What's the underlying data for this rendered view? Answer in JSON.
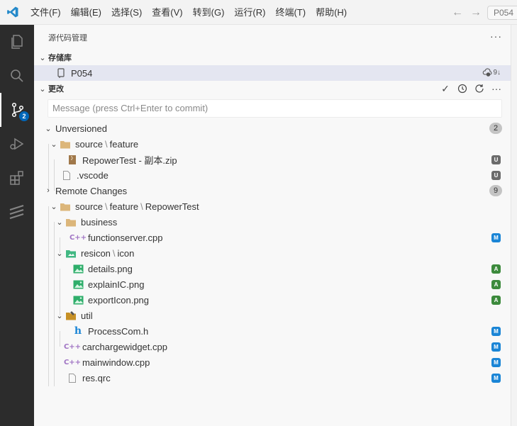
{
  "menu": [
    "文件(F)",
    "编辑(E)",
    "选择(S)",
    "查看(V)",
    "转到(G)",
    "运行(R)",
    "终端(T)",
    "帮助(H)"
  ],
  "command_center_text": "P054",
  "activity": {
    "scm_badge": "2"
  },
  "pane": {
    "title": "源代码管理",
    "more": "···"
  },
  "repositories": {
    "title": "存储库",
    "repo_name": "P054",
    "sync_count": "9↓"
  },
  "changes": {
    "title": "更改",
    "more": "···",
    "commit_placeholder": "Message (press Ctrl+Enter to commit)"
  },
  "unversioned": {
    "label": "Unversioned",
    "count": "2",
    "folder": {
      "parts": [
        "source",
        "feature"
      ]
    },
    "items": [
      {
        "name": "RepowerTest - 副本.zip",
        "status": "U"
      },
      {
        "name": ".vscode",
        "status": "U"
      }
    ]
  },
  "remote": {
    "label": "Remote Changes",
    "count": "9",
    "root_folder": {
      "parts": [
        "source",
        "feature",
        "RepowerTest"
      ]
    },
    "business": {
      "label": "business",
      "file": "functionserver.cpp",
      "status": "M"
    },
    "resicon": {
      "parts": [
        "resicon",
        "icon"
      ],
      "files": [
        {
          "name": "details.png",
          "status": "A"
        },
        {
          "name": "explainIC.png",
          "status": "A"
        },
        {
          "name": "exportIcon.png",
          "status": "A"
        }
      ]
    },
    "util": {
      "label": "util",
      "file": "ProcessCom.h",
      "status": "M"
    },
    "root_files": [
      {
        "name": "carchargewidget.cpp",
        "status": "M"
      },
      {
        "name": "mainwindow.cpp",
        "status": "M"
      },
      {
        "name": "res.qrc",
        "status": "M"
      }
    ]
  },
  "colors": {
    "accent": "#0066b8",
    "activitybar": "#2c2c2c",
    "modified": "#1a85d6",
    "added": "#3c8a3c",
    "untracked": "#6b6b6b"
  }
}
